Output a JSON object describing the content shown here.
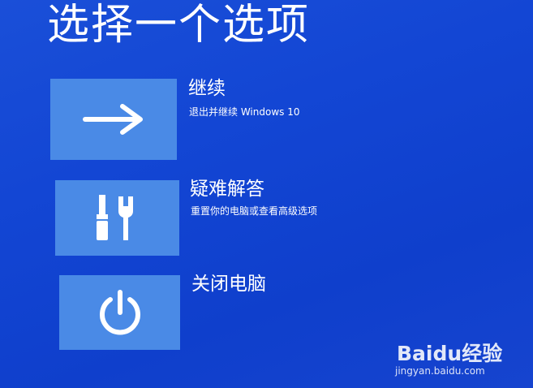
{
  "page_title": "选择一个选项",
  "options": [
    {
      "label": "继续",
      "description": "退出并继续 Windows 10",
      "icon": "arrow-right-icon"
    },
    {
      "label": "疑难解答",
      "description": "重置你的电脑或查看高级选项",
      "icon": "tools-icon"
    },
    {
      "label": "关闭电脑",
      "description": "",
      "icon": "power-icon"
    }
  ],
  "watermark": {
    "logo_text": "Baidu经验",
    "url": "jingyan.baidu.com"
  },
  "colors": {
    "background": "#1346d4",
    "tile": "#4a8ae6",
    "text": "#ffffff"
  }
}
